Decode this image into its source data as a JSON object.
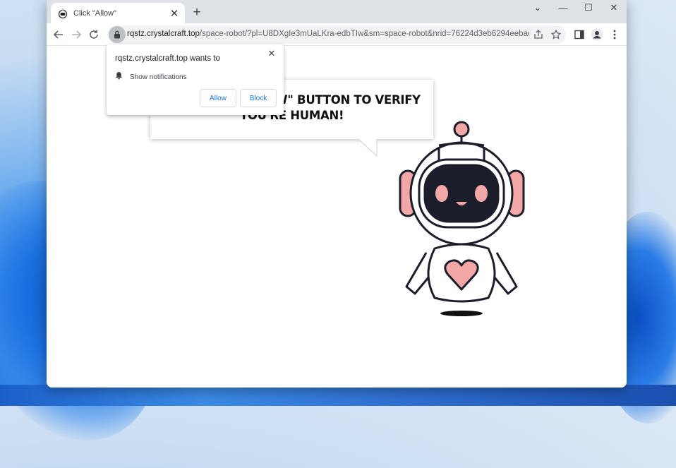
{
  "tab": {
    "title": "Click \"Allow\"",
    "close": "✕"
  },
  "window_controls": {
    "chevron": "⌄",
    "minimize": "—",
    "maximize": "☐",
    "close": "✕"
  },
  "toolbar": {
    "url_host": "rqstz.crystalcraft.top",
    "url_rest": "/space-robot/?pl=U8DXgIe3mUaLKra-edbTIw&sm=space-robot&nrid=76224d3eb6294eebae3e..."
  },
  "permission_prompt": {
    "title": "rqstz.crystalcraft.top wants to",
    "item": "Show notifications",
    "allow_label": "Allow",
    "block_label": "Block"
  },
  "page": {
    "headline_line1": "PRESS THE \"ALLOW\" BUTTON TO VERIFY",
    "headline_line2": "YOU'RE HUMAN!"
  },
  "icons": [
    "robot-favicon-icon",
    "back-icon",
    "forward-icon",
    "reload-icon",
    "lock-icon",
    "share-icon",
    "bookmark-star-icon",
    "side-panel-icon",
    "profile-icon",
    "menu-icon",
    "bell-icon",
    "close-icon"
  ],
  "colors": {
    "accent": "#1a73e8",
    "robot_pink": "#f4a7a7",
    "robot_visor": "#1c1d2b"
  }
}
